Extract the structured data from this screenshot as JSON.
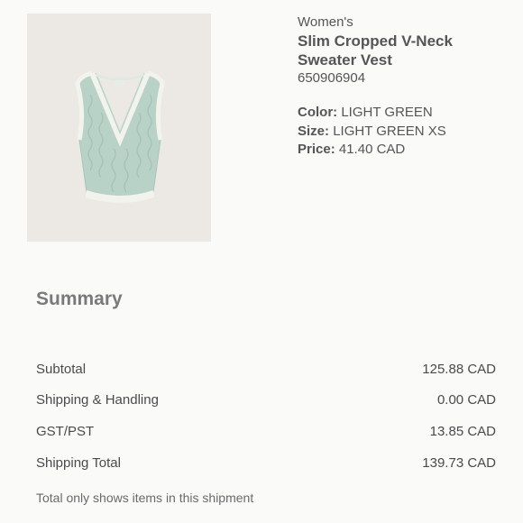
{
  "product": {
    "image_icon": "sweater-vest-image",
    "category": "Women's",
    "name": "Slim Cropped V-Neck Sweater Vest",
    "sku": "650906904",
    "attributes": [
      {
        "label": "Color:",
        "value": "LIGHT GREEN"
      },
      {
        "label": "Size:",
        "value": "LIGHT GREEN XS"
      },
      {
        "label": "Price:",
        "value": "41.40 CAD"
      }
    ]
  },
  "summary": {
    "title": "Summary",
    "rows": [
      {
        "label": "Subtotal",
        "value": "125.88 CAD"
      },
      {
        "label": "Shipping & Handling",
        "value": "0.00 CAD"
      },
      {
        "label": "GST/PST",
        "value": "13.85 CAD"
      },
      {
        "label": "Shipping Total",
        "value": "139.73 CAD"
      }
    ],
    "note": "Total only shows items in this shipment"
  },
  "colors": {
    "background": "#fafaf8",
    "image_background": "#ece9e4",
    "sweater": "#b9d2c8",
    "trim": "#f3f3ee"
  }
}
